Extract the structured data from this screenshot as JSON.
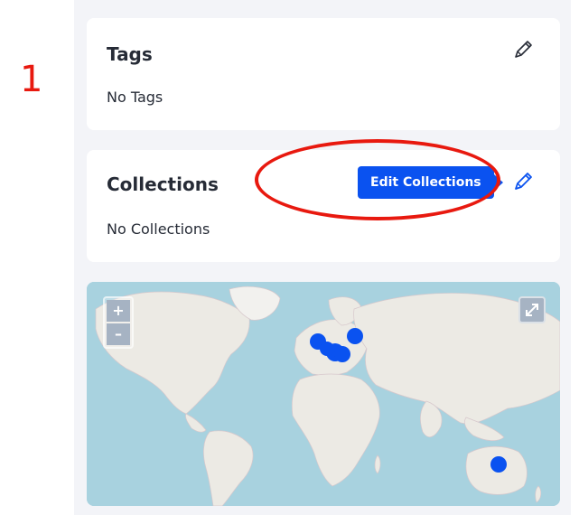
{
  "annotation": {
    "step_number": "1",
    "highlight_color": "#e8190f"
  },
  "tags_card": {
    "title": "Tags",
    "empty_text": "No Tags",
    "edit_icon": "pencil-icon"
  },
  "collections_card": {
    "title": "Collections",
    "empty_text": "No Collections",
    "edit_icon": "pencil-icon",
    "tooltip": "Edit Collections"
  },
  "map": {
    "zoom_in_label": "+",
    "zoom_out_label": "–",
    "fullscreen_icon": "expand-icon",
    "marker_color": "#0a52f0",
    "markers": [
      "Western Europe",
      "Central Europe",
      "Scandinavia",
      "Western Europe 2",
      "Australia"
    ]
  }
}
